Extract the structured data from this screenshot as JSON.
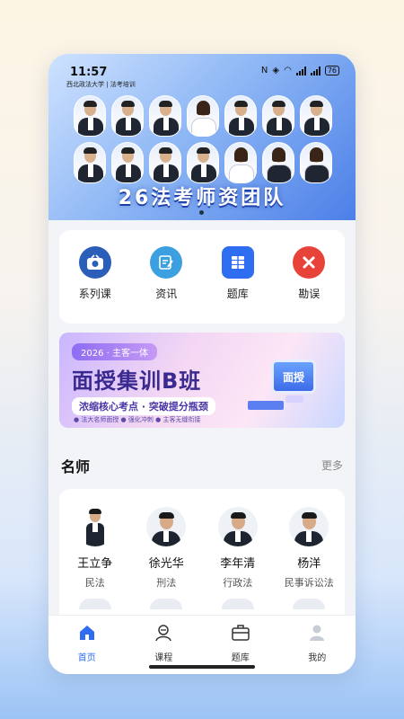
{
  "status_bar": {
    "time": "11:57",
    "school": "西北政法大学 | 法考培训",
    "battery": "76"
  },
  "hero": {
    "title": "26法考师资团队",
    "icon": "teacher-group-photo"
  },
  "menu": {
    "items": [
      {
        "label": "系列课",
        "icon": "tv-camera-icon",
        "color": "#2b5eb8"
      },
      {
        "label": "资讯",
        "icon": "document-edit-icon",
        "color": "#3c9fe0"
      },
      {
        "label": "题库",
        "icon": "stack-book-icon",
        "color": "#2f6df0"
      },
      {
        "label": "勘误",
        "icon": "close-icon",
        "color": "#e8433a"
      }
    ]
  },
  "banner": {
    "tag": "2026 · 主客一体",
    "title": "面授集训B班",
    "subtitle": "浓缩核心考点 · 突破提分瓶颈",
    "small": "● 法大名师面授   ● 强化冲刺   ● 主客无缝衔接",
    "screen_text": "面授"
  },
  "section": {
    "title": "名师",
    "more": "更多"
  },
  "teachers": [
    {
      "name": "王立争",
      "subject": "民法"
    },
    {
      "name": "徐光华",
      "subject": "刑法"
    },
    {
      "name": "李年清",
      "subject": "行政法"
    },
    {
      "name": "杨洋",
      "subject": "民事诉讼法"
    }
  ],
  "tabbar": {
    "tabs": [
      {
        "label": "首页",
        "icon": "home-icon"
      },
      {
        "label": "课程",
        "icon": "course-icon"
      },
      {
        "label": "题库",
        "icon": "briefcase-icon"
      },
      {
        "label": "我的",
        "icon": "person-icon"
      }
    ],
    "active_color": "#2f6df0"
  }
}
